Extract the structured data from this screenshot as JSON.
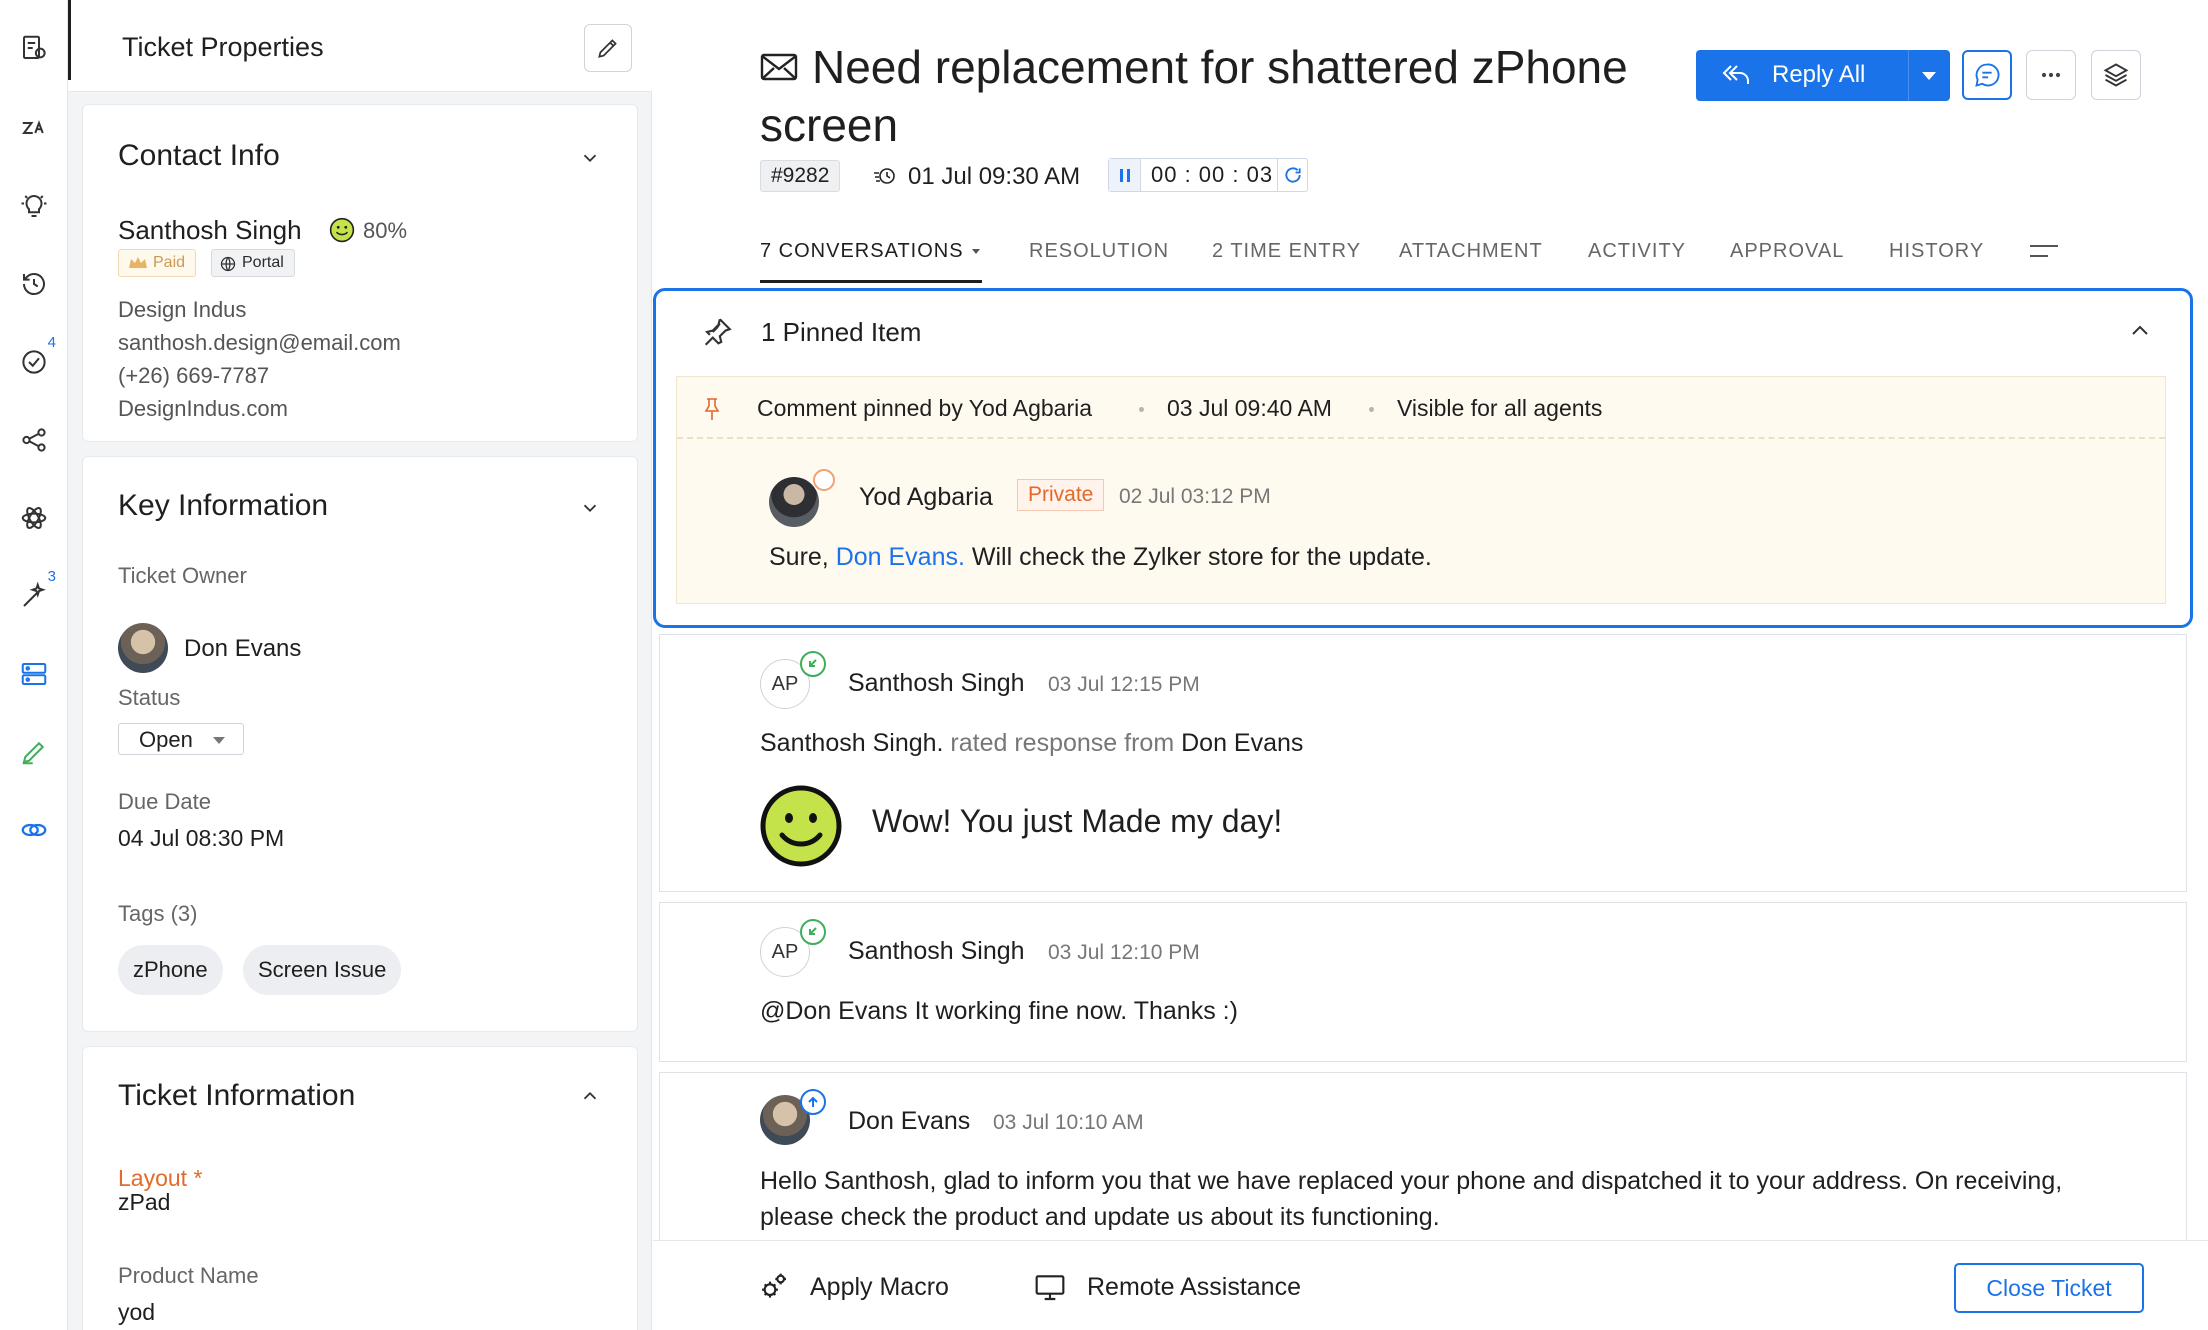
{
  "rail": {
    "badges": {
      "tasks": "4",
      "wand": "3"
    }
  },
  "properties": {
    "title": "Ticket Properties",
    "contact": {
      "heading": "Contact Info",
      "name": "Santhosh Singh",
      "csat": "80%",
      "paid": "Paid",
      "portal": "Portal",
      "company": "Design Indus",
      "email": "santhosh.design@email.com",
      "phone": "(+26) 669-7787",
      "website": "DesignIndus.com"
    },
    "key": {
      "heading": "Key Information",
      "owner_label": "Ticket Owner",
      "owner": "Don Evans",
      "status_label": "Status",
      "status": "Open",
      "due_label": "Due Date",
      "due": "04 Jul 08:30 PM",
      "tags_label": "Tags (3)",
      "tags": [
        "zPhone",
        "Screen Issue"
      ]
    },
    "ticket_info": {
      "heading": "Ticket Information",
      "layout_label": "Layout *",
      "layout": "zPad",
      "product_label": "Product Name",
      "product": "yod"
    }
  },
  "ticket": {
    "title": "Need replacement for shattered zPhone screen",
    "id": "#9282",
    "due": "01 Jul 09:30 AM",
    "timer": "00 : 00 : 03",
    "reply_all": "Reply All"
  },
  "tabs": [
    {
      "label": "7 CONVERSATIONS"
    },
    {
      "label": "RESOLUTION"
    },
    {
      "label": "2 TIME ENTRY"
    },
    {
      "label": "ATTACHMENT"
    },
    {
      "label": "ACTIVITY"
    },
    {
      "label": "APPROVAL"
    },
    {
      "label": "HISTORY"
    }
  ],
  "pinned": {
    "heading": "1 Pinned Item",
    "pinned_by": "Comment pinned by Yod Agbaria",
    "pinned_at": "03 Jul 09:40 AM",
    "visibility": "Visible for all agents",
    "author": "Yod Agbaria",
    "privacy": "Private",
    "time": "02 Jul 03:12 PM",
    "text_before": "Sure, ",
    "mention": "Don Evans.",
    "text_after": " Will check the Zylker store for the update."
  },
  "conversations": [
    {
      "initials": "AP",
      "author": "Santhosh Singh",
      "time": "03 Jul 12:15 PM",
      "rated_name": "Santhosh Singh.",
      "rated_text": " rated response from ",
      "rated_agent": "Don Evans",
      "rating_text": "Wow! You just Made my day!"
    },
    {
      "initials": "AP",
      "author": "Santhosh Singh",
      "time": "03 Jul 12:10 PM",
      "text": "@Don Evans It working fine now. Thanks :)"
    },
    {
      "author": "Don Evans",
      "time": "03 Jul 10:10 AM",
      "text": "Hello Santhosh, glad to inform you that we have replaced your phone and dispatched it to your address. On receiving, please check the product and update us about its functioning."
    }
  ],
  "footer": {
    "apply_macro": "Apply Macro",
    "remote_assistance": "Remote Assistance",
    "close_ticket": "Close Ticket"
  },
  "colors": {
    "accent": "#1a73e8",
    "private": "#e2682c",
    "pinned_bg": "#fffaf0",
    "success": "#3fae5a"
  }
}
